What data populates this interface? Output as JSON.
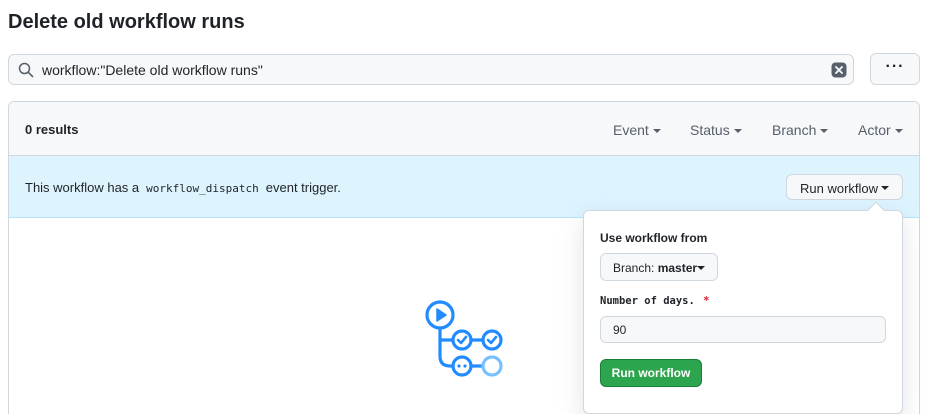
{
  "page": {
    "title": "Delete old workflow runs"
  },
  "search": {
    "value": "workflow:\"Delete old workflow runs\""
  },
  "toolbar": {
    "more_label": "···"
  },
  "results": {
    "count_label": "0 results",
    "filters": [
      "Event",
      "Status",
      "Branch",
      "Actor"
    ]
  },
  "banner": {
    "text_before": "This workflow has a",
    "code": "workflow_dispatch",
    "text_after": "event trigger.",
    "run_button_label": "Run workflow"
  },
  "popover": {
    "use_from_label": "Use workflow from",
    "branch_prefix": "Branch:",
    "branch_value": "master",
    "days_label": "Number of days.",
    "required_marker": "*",
    "days_value": "90",
    "submit_label": "Run workflow"
  },
  "colors": {
    "accent_blue": "#218bff",
    "banner_bg": "#ddf4ff",
    "primary_green": "#2da44e",
    "danger_red": "#cf222e"
  },
  "icons": {
    "search": "search-icon",
    "clear": "x-circle-fill-icon",
    "empty_state": "workflow-icon"
  }
}
